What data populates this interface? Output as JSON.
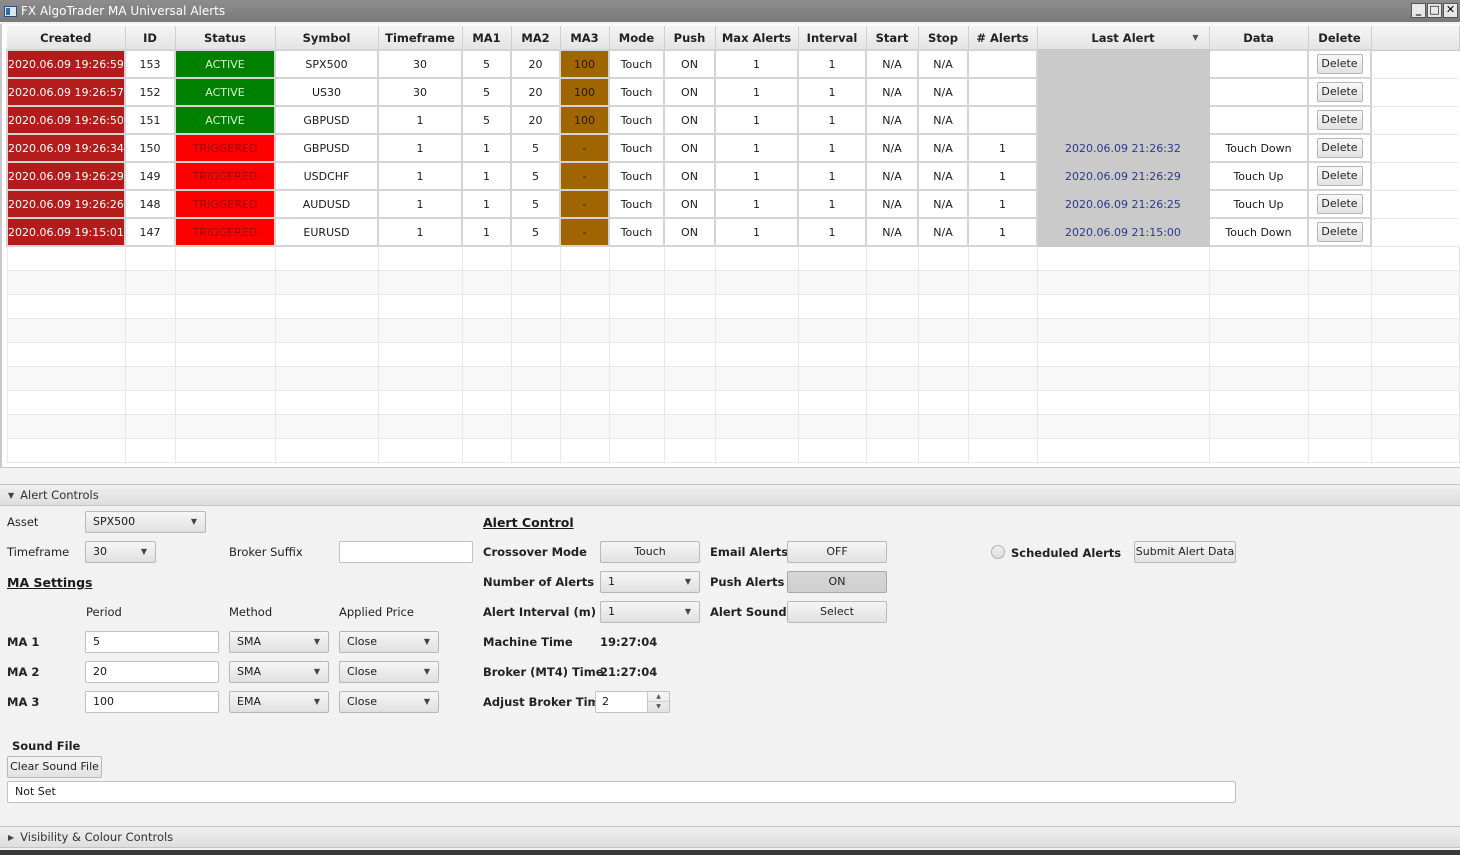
{
  "window": {
    "title": "FX AlgoTrader MA Universal Alerts",
    "controls": {
      "minimize": "_",
      "maximize": "□",
      "close": "✕"
    }
  },
  "table": {
    "columns": [
      "Created",
      "ID",
      "Status",
      "Symbol",
      "Timeframe",
      "MA1",
      "MA2",
      "MA3",
      "Mode",
      "Push",
      "Max Alerts",
      "Interval",
      "Start",
      "Stop",
      "# Alerts",
      "Last Alert",
      "Data",
      "Delete"
    ],
    "sorted_column": "Last Alert",
    "rows": [
      {
        "created": "2020.06.09 19:26:59",
        "id": "153",
        "status": "ACTIVE",
        "symbol": "SPX500",
        "timeframe": "30",
        "ma1": "5",
        "ma2": "20",
        "ma3": "100",
        "mode": "Touch",
        "push": "ON",
        "max_alerts": "1",
        "interval": "1",
        "start": "N/A",
        "stop": "N/A",
        "alerts": "",
        "last_alert": "",
        "data": "",
        "delete": "Delete"
      },
      {
        "created": "2020.06.09 19:26:57",
        "id": "152",
        "status": "ACTIVE",
        "symbol": "US30",
        "timeframe": "30",
        "ma1": "5",
        "ma2": "20",
        "ma3": "100",
        "mode": "Touch",
        "push": "ON",
        "max_alerts": "1",
        "interval": "1",
        "start": "N/A",
        "stop": "N/A",
        "alerts": "",
        "last_alert": "",
        "data": "",
        "delete": "Delete"
      },
      {
        "created": "2020.06.09 19:26:50",
        "id": "151",
        "status": "ACTIVE",
        "symbol": "GBPUSD",
        "timeframe": "1",
        "ma1": "5",
        "ma2": "20",
        "ma3": "100",
        "mode": "Touch",
        "push": "ON",
        "max_alerts": "1",
        "interval": "1",
        "start": "N/A",
        "stop": "N/A",
        "alerts": "",
        "last_alert": "",
        "data": "",
        "delete": "Delete"
      },
      {
        "created": "2020.06.09 19:26:34",
        "id": "150",
        "status": "TRIGGERED",
        "symbol": "GBPUSD",
        "timeframe": "1",
        "ma1": "1",
        "ma2": "5",
        "ma3": "-",
        "mode": "Touch",
        "push": "ON",
        "max_alerts": "1",
        "interval": "1",
        "start": "N/A",
        "stop": "N/A",
        "alerts": "1",
        "last_alert": "2020.06.09 21:26:32",
        "data": "Touch Down",
        "delete": "Delete"
      },
      {
        "created": "2020.06.09 19:26:29",
        "id": "149",
        "status": "TRIGGERED",
        "symbol": "USDCHF",
        "timeframe": "1",
        "ma1": "1",
        "ma2": "5",
        "ma3": "-",
        "mode": "Touch",
        "push": "ON",
        "max_alerts": "1",
        "interval": "1",
        "start": "N/A",
        "stop": "N/A",
        "alerts": "1",
        "last_alert": "2020.06.09 21:26:29",
        "data": "Touch Up",
        "delete": "Delete"
      },
      {
        "created": "2020.06.09 19:26:26",
        "id": "148",
        "status": "TRIGGERED",
        "symbol": "AUDUSD",
        "timeframe": "1",
        "ma1": "1",
        "ma2": "5",
        "ma3": "-",
        "mode": "Touch",
        "push": "ON",
        "max_alerts": "1",
        "interval": "1",
        "start": "N/A",
        "stop": "N/A",
        "alerts": "1",
        "last_alert": "2020.06.09 21:26:25",
        "data": "Touch Up",
        "delete": "Delete"
      },
      {
        "created": "2020.06.09 19:15:01",
        "id": "147",
        "status": "TRIGGERED",
        "symbol": "EURUSD",
        "timeframe": "1",
        "ma1": "1",
        "ma2": "5",
        "ma3": "-",
        "mode": "Touch",
        "push": "ON",
        "max_alerts": "1",
        "interval": "1",
        "start": "N/A",
        "stop": "N/A",
        "alerts": "1",
        "last_alert": "2020.06.09 21:15:00",
        "data": "Touch Down",
        "delete": "Delete"
      }
    ],
    "colors": {
      "created": "#b41c1c",
      "active": "#008000",
      "triggered": "#ff0000",
      "ma3": "#9e6500",
      "last_alert_bg": "#cacaca",
      "last_alert_text": "#2c3a8c"
    }
  },
  "alert_controls": {
    "header": "Alert Controls",
    "expanded": true,
    "asset": {
      "label": "Asset",
      "value": "SPX500"
    },
    "timeframe": {
      "label": "Timeframe",
      "value": "30"
    },
    "broker_suffix": {
      "label": "Broker Suffix",
      "value": ""
    },
    "ma_settings": {
      "title": "MA Settings",
      "col_period": "Period",
      "col_method": "Method",
      "col_price": "Applied Price",
      "rows": [
        {
          "label": "MA 1",
          "period": "5",
          "method": "SMA",
          "price": "Close"
        },
        {
          "label": "MA 2",
          "period": "20",
          "method": "SMA",
          "price": "Close"
        },
        {
          "label": "MA 3",
          "period": "100",
          "method": "EMA",
          "price": "Close"
        }
      ]
    },
    "alert_control": {
      "title": "Alert Control",
      "crossover_mode": {
        "label": "Crossover Mode",
        "value": "Touch"
      },
      "number_of_alerts": {
        "label": "Number of Alerts",
        "value": "1"
      },
      "alert_interval": {
        "label": "Alert Interval (m)",
        "value": "1"
      },
      "machine_time": {
        "label": "Machine Time",
        "value": "19:27:04"
      },
      "broker_time": {
        "label": "Broker (MT4) Time",
        "value": "21:27:04"
      },
      "adjust_broker_time": {
        "label": "Adjust Broker Time",
        "value": "2"
      },
      "email_alerts": {
        "label": "Email Alerts",
        "value": "OFF"
      },
      "push_alerts": {
        "label": "Push Alerts",
        "value": "ON"
      },
      "alert_sound": {
        "label": "Alert Sound",
        "value": "Select"
      }
    },
    "scheduled_alerts": {
      "label": "Scheduled Alerts",
      "checked": false
    },
    "submit_button": "Submit Alert Data",
    "sound_file": {
      "title": "Sound File",
      "clear_button": "Clear Sound File",
      "value": "Not Set"
    }
  },
  "visibility_controls": {
    "header": "Visibility & Colour Controls",
    "expanded": false
  }
}
